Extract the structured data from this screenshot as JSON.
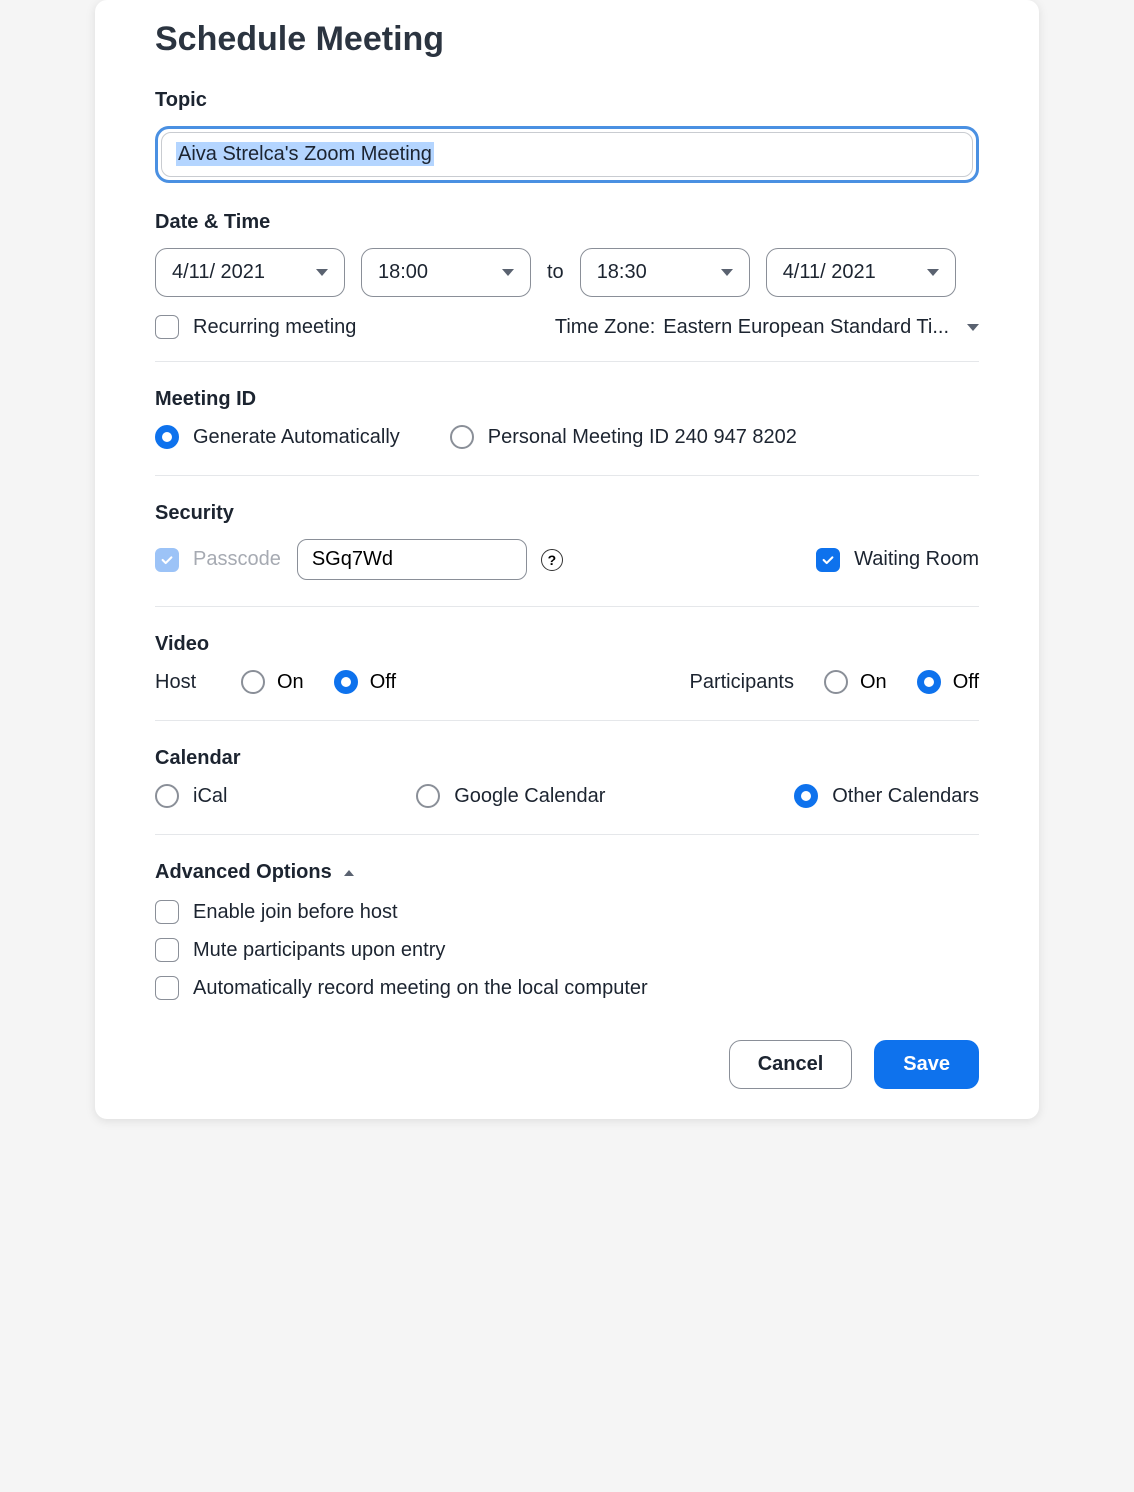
{
  "title": "Schedule Meeting",
  "topic": {
    "label": "Topic",
    "value": "Aiva Strelca's Zoom Meeting"
  },
  "datetime": {
    "label": "Date & Time",
    "start_date": "4/11/ 2021",
    "start_time": "18:00",
    "to_label": "to",
    "end_time": "18:30",
    "end_date": "4/11/ 2021",
    "recurring_label": "Recurring meeting",
    "recurring_checked": false,
    "timezone_label": "Time Zone:",
    "timezone_value": "Eastern European Standard Ti..."
  },
  "meeting_id": {
    "label": "Meeting ID",
    "generate_label": "Generate Automatically",
    "personal_label": "Personal Meeting ID 240 947 8202",
    "selected": "generate"
  },
  "security": {
    "label": "Security",
    "passcode_label": "Passcode",
    "passcode_value": "SGq7Wd",
    "passcode_checked": true,
    "waiting_room_label": "Waiting Room",
    "waiting_room_checked": true
  },
  "video": {
    "label": "Video",
    "host_label": "Host",
    "participants_label": "Participants",
    "on_label": "On",
    "off_label": "Off",
    "host_selected": "off",
    "participants_selected": "off"
  },
  "calendar": {
    "label": "Calendar",
    "ical_label": "iCal",
    "google_label": "Google Calendar",
    "other_label": "Other Calendars",
    "selected": "other"
  },
  "advanced": {
    "label": "Advanced Options",
    "expanded": true,
    "options": [
      {
        "label": "Enable join before host",
        "checked": false
      },
      {
        "label": "Mute participants upon entry",
        "checked": false
      },
      {
        "label": "Automatically record meeting on the local computer",
        "checked": false
      }
    ]
  },
  "footer": {
    "cancel_label": "Cancel",
    "save_label": "Save"
  }
}
